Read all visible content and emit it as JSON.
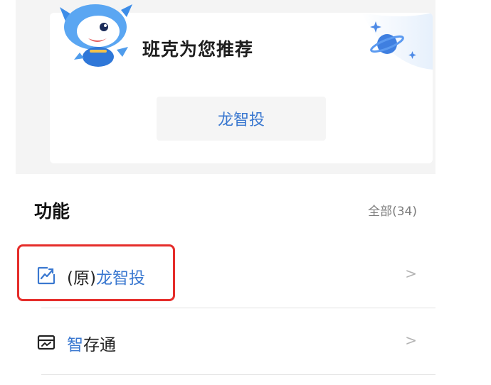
{
  "recommend": {
    "title": "班克为您推荐",
    "chip_label": "龙智投"
  },
  "features": {
    "title": "功能",
    "all_label": "全部(34)",
    "items": [
      {
        "prefix": "(原)",
        "highlight": "龙智投",
        "suffix": "",
        "icon": "trend-chart-icon"
      },
      {
        "prefix": "",
        "highlight": "智",
        "suffix": "存通",
        "icon": "wallet-chart-icon"
      }
    ],
    "chevron": ">"
  },
  "colors": {
    "accent": "#3a78d0",
    "highlight_border": "#e52d2a"
  }
}
